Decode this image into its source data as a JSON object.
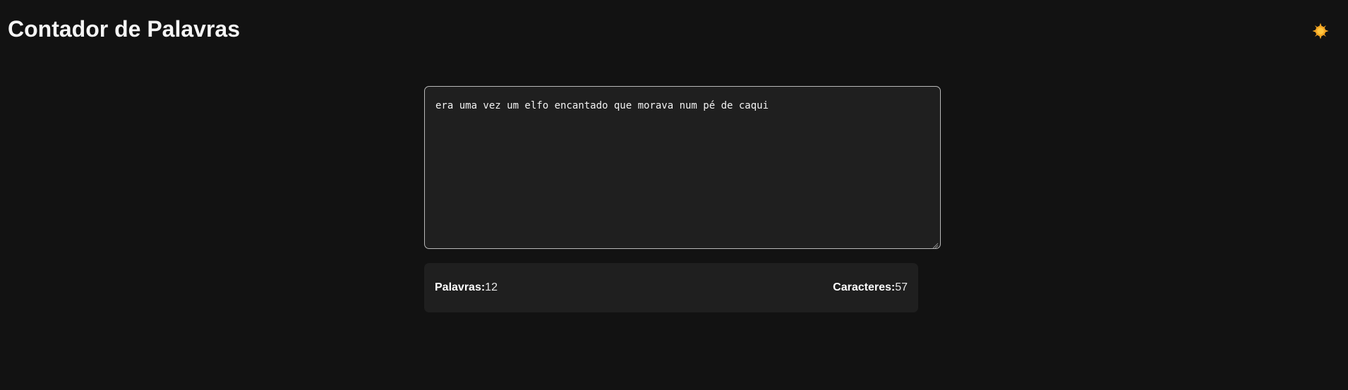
{
  "header": {
    "title": "Contador de Palavras",
    "theme_toggle_icon": "sun-icon"
  },
  "editor": {
    "value": "era uma vez um elfo encantado que morava num pé de caqui",
    "placeholder": ""
  },
  "stats": {
    "words_label": "Palavras:",
    "words_value": "12",
    "chars_label": "Caracteres:",
    "chars_value": "57"
  },
  "colors": {
    "background": "#121212",
    "panel": "#1f1f1f",
    "border": "#b9b9b9",
    "sun": "#f5a623"
  }
}
